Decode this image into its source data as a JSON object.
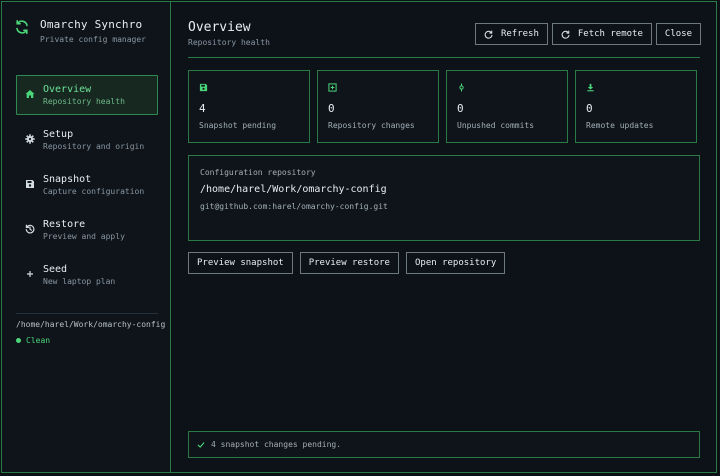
{
  "app": {
    "title": "Omarchy Synchro",
    "subtitle": "Private config manager"
  },
  "sidebar": {
    "items": [
      {
        "title": "Overview",
        "subtitle": "Repository health",
        "icon": "home-icon",
        "active": true
      },
      {
        "title": "Setup",
        "subtitle": "Repository and origin",
        "icon": "gear-icon"
      },
      {
        "title": "Snapshot",
        "subtitle": "Capture configuration",
        "icon": "save-icon"
      },
      {
        "title": "Restore",
        "subtitle": "Preview and apply",
        "icon": "restore-icon"
      },
      {
        "title": "Seed",
        "subtitle": "New laptop plan",
        "icon": "plus-icon"
      }
    ],
    "repo_path": "/home/harel/Work/omarchy-config",
    "status": "Clean"
  },
  "header": {
    "title": "Overview",
    "subtitle": "Repository health",
    "buttons": {
      "refresh": "Refresh",
      "fetch": "Fetch remote",
      "close": "Close"
    }
  },
  "stats": [
    {
      "value": "4",
      "label": "Snapshot pending",
      "icon": "save-icon"
    },
    {
      "value": "0",
      "label": "Repository changes",
      "icon": "diff-icon"
    },
    {
      "value": "0",
      "label": "Unpushed commits",
      "icon": "commit-icon"
    },
    {
      "value": "0",
      "label": "Remote updates",
      "icon": "download-icon"
    }
  ],
  "repository": {
    "label": "Configuration repository",
    "path": "/home/harel/Work/omarchy-config",
    "remote": "git@github.com:harel/omarchy-config.git"
  },
  "actions": {
    "preview_snapshot": "Preview snapshot",
    "preview_restore": "Preview restore",
    "open_repository": "Open repository"
  },
  "statusbar": {
    "message": "4 snapshot changes pending."
  },
  "colors": {
    "accent": "#4cd67a",
    "border": "#2a7a46",
    "background": "#0d1218"
  }
}
